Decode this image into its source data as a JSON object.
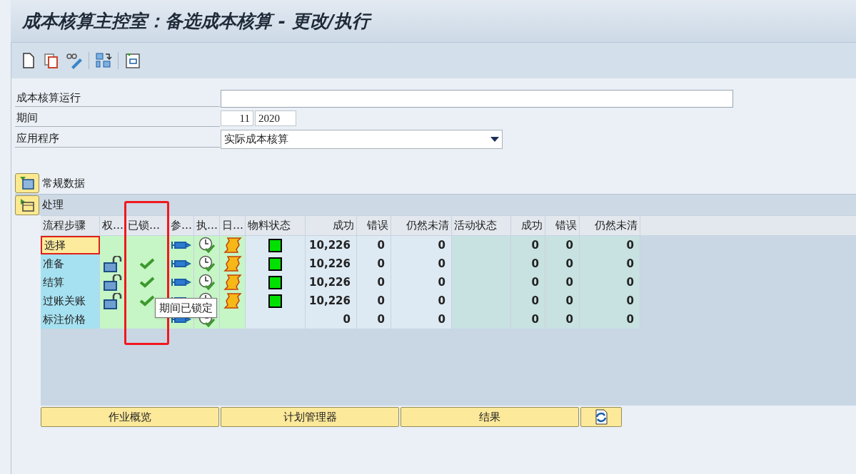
{
  "window": {
    "title": "成本核算主控室：备选成本核算 - 更改/执行"
  },
  "form": {
    "run": {
      "label": "成本核算运行"
    },
    "period": {
      "label": "期间",
      "month": "11",
      "year": "2020"
    },
    "application": {
      "label": "应用程序",
      "value": "实际成本核算"
    }
  },
  "sections": [
    {
      "label": "常规数据",
      "expanded": false
    },
    {
      "label": "处理",
      "expanded": true
    }
  ],
  "table": {
    "columns": [
      "流程步骤",
      "权…",
      "已锁…",
      "参…",
      "执…",
      "日…",
      "物料状态",
      "成功",
      "错误",
      "仍然未清",
      "活动状态",
      "成功",
      "错误",
      "仍然未清"
    ],
    "rows": [
      {
        "step": "选择",
        "selected": true,
        "unlocked": false,
        "locked": false,
        "log": true,
        "material_ok": true,
        "success": "10,226",
        "errors": "0",
        "open": "0",
        "success2": "0",
        "errors2": "0",
        "open2": "0"
      },
      {
        "step": "准备",
        "selected": false,
        "unlocked": true,
        "locked": true,
        "log": true,
        "material_ok": true,
        "success": "10,226",
        "errors": "0",
        "open": "0",
        "success2": "0",
        "errors2": "0",
        "open2": "0"
      },
      {
        "step": "结算",
        "selected": false,
        "unlocked": true,
        "locked": true,
        "log": true,
        "material_ok": true,
        "success": "10,226",
        "errors": "0",
        "open": "0",
        "success2": "0",
        "errors2": "0",
        "open2": "0"
      },
      {
        "step": "过账关账",
        "selected": false,
        "unlocked": true,
        "locked": true,
        "log": true,
        "material_ok": true,
        "success": "10,226",
        "errors": "0",
        "open": "0",
        "success2": "0",
        "errors2": "0",
        "open2": "0"
      },
      {
        "step": "标注价格",
        "selected": false,
        "unlocked": false,
        "locked": false,
        "log": false,
        "material_ok": false,
        "success": "0",
        "errors": "0",
        "open": "0",
        "success2": "0",
        "errors2": "0",
        "open2": "0"
      }
    ]
  },
  "tooltip": "期间已锁定",
  "buttons": [
    "作业概览",
    "计划管理器",
    "结果"
  ]
}
